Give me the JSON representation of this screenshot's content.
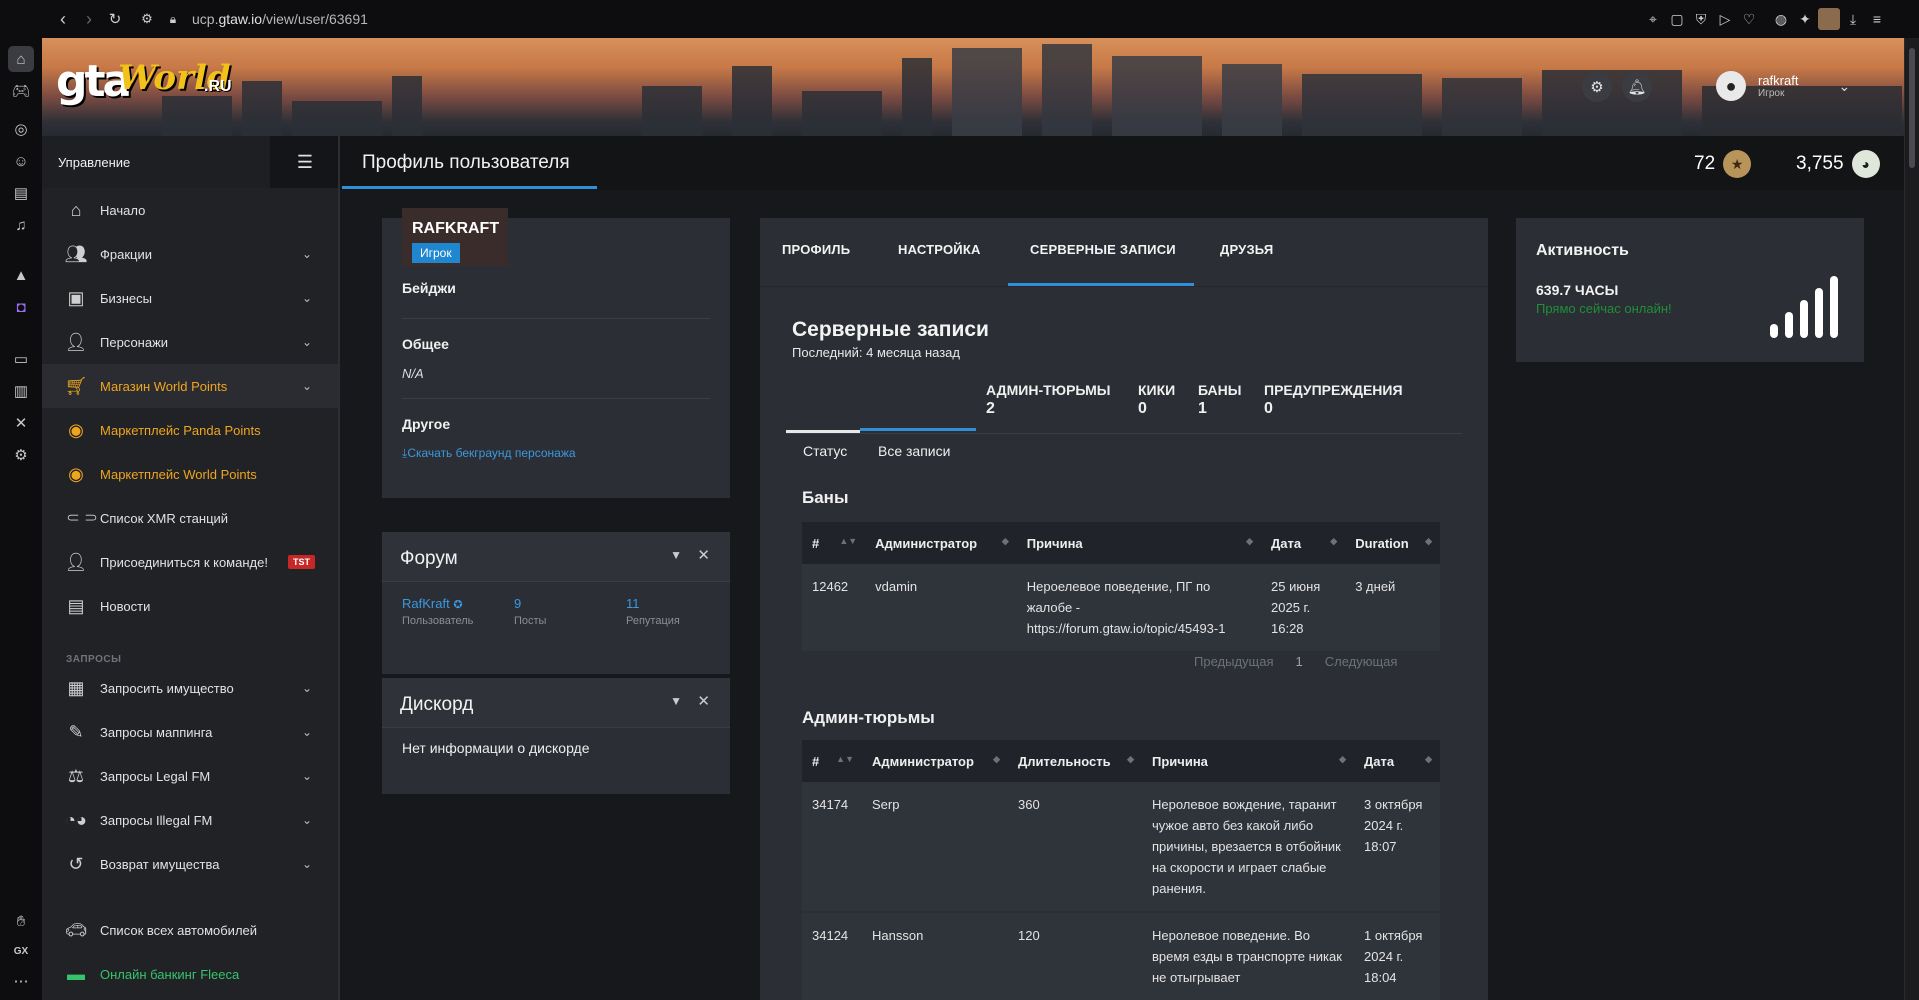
{
  "browser": {
    "url_prefix": "ucp.",
    "url_host": "gtaw.io",
    "url_path": "/view/user/63691"
  },
  "header": {
    "logo_main": "gta",
    "logo_world": "World",
    "logo_ru": ".RU",
    "username": "rafkraft",
    "user_role": "Игрок"
  },
  "sidebar": {
    "title": "Управление",
    "items": [
      {
        "label": "Начало",
        "icon": "home-icon"
      },
      {
        "label": "Фракции",
        "icon": "users-icon"
      },
      {
        "label": "Бизнесы",
        "icon": "briefcase-icon"
      },
      {
        "label": "Персонажи",
        "icon": "user-icon"
      },
      {
        "label": "Магазин World Points",
        "icon": "cart-icon"
      },
      {
        "label": "Маркетплейс Panda Points",
        "icon": "coins-icon"
      },
      {
        "label": "Маркетплейс World Points",
        "icon": "coins-icon"
      },
      {
        "label": "Список XMR станций",
        "icon": "antenna-icon"
      },
      {
        "label": "Присоединиться к команде!",
        "icon": "user-tie-icon",
        "badge": "TST"
      },
      {
        "label": "Новости",
        "icon": "newspaper-icon"
      }
    ],
    "section_label": "ЗАПРОСЫ",
    "requests": [
      {
        "label": "Запросить имущество",
        "icon": "building-icon"
      },
      {
        "label": "Запросы маппинга",
        "icon": "brush-icon"
      },
      {
        "label": "Запросы Legal FM",
        "icon": "scales-icon"
      },
      {
        "label": "Запросы Illegal FM",
        "icon": "mask-icon"
      },
      {
        "label": "Возврат имущества",
        "icon": "undo-icon"
      }
    ],
    "bottom": [
      {
        "label": "Список всех автомобилей",
        "icon": "car-icon"
      },
      {
        "label": "Онлайн банкинг Fleeca",
        "icon": "money-icon"
      }
    ]
  },
  "page": {
    "title": "Профиль пользователя",
    "points_a": "72",
    "points_b": "3,755"
  },
  "profile": {
    "name": "RAFKRAFT",
    "role": "Игрок",
    "badges_label": "Бейджи",
    "general_label": "Общее",
    "general_value": "N/A",
    "other_label": "Другое",
    "download_link": "Скачать бекграунд персонажа"
  },
  "forum": {
    "title": "Форум",
    "user": "RafKraft",
    "user_sub": "Пользователь",
    "posts": "9",
    "posts_sub": "Посты",
    "rep": "11",
    "rep_sub": "Репутация"
  },
  "discord": {
    "title": "Дискорд",
    "text": "Нет информации о дискорде"
  },
  "tabs": [
    "ПРОФИЛЬ",
    "НАСТРОЙКА",
    "СЕРВЕРНЫЕ ЗАПИСИ",
    "ДРУЗЬЯ"
  ],
  "records": {
    "title": "Серверные записи",
    "subtitle": "Последний: 4 месяца назад",
    "stats": [
      {
        "label": "АДМИН-ТЮРЬМЫ",
        "value": "2"
      },
      {
        "label": "КИКИ",
        "value": "0"
      },
      {
        "label": "БАНЫ",
        "value": "1"
      },
      {
        "label": "ПРЕДУПРЕЖДЕНИЯ",
        "value": "0"
      }
    ],
    "subtabs": [
      "Статус",
      "Все записи"
    ],
    "bans": {
      "title": "Баны",
      "columns": [
        "#",
        "Администратор",
        "Причина",
        "Дата",
        "Duration"
      ],
      "rows": [
        {
          "id": "12462",
          "admin": "vdamin",
          "reason": "Нероелевое поведение, ПГ по жалобе - https://forum.gtaw.io/topic/45493-1",
          "date": "25 июня 2025 г. 16:28",
          "duration": "3 дней"
        }
      ],
      "pager_prev": "Предыдущая",
      "pager_page": "1",
      "pager_next": "Следующая"
    },
    "jails": {
      "title": "Админ-тюрьмы",
      "columns": [
        "#",
        "Администратор",
        "Длительность",
        "Причина",
        "Дата"
      ],
      "rows": [
        {
          "id": "34174",
          "admin": "Serp",
          "length": "360",
          "reason": "Неролевое вождение, таранит чужое авто без какой либо причины, врезается в отбойник на скорости и играет слабые ранения.",
          "date": "3 октября 2024 г. 18:07"
        },
        {
          "id": "34124",
          "admin": "Hansson",
          "length": "120",
          "reason": "Неролевое поведение. Во время езды в транспорте никак не отыгрывает",
          "date": "1 октября 2024 г. 18:04"
        }
      ]
    }
  },
  "activity": {
    "title": "Активность",
    "hours": "639.7 ЧАСЫ",
    "status": "Прямо сейчас онлайн!",
    "signal_level": 5
  }
}
